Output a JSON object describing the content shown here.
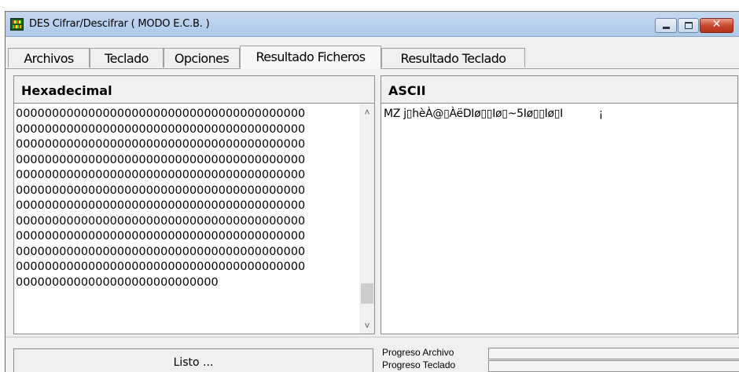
{
  "window": {
    "title": "DES Cifrar/Descifrar ( MODO E.C.B. )",
    "close_glyph": "✕"
  },
  "tabs": [
    {
      "label": "Archivos",
      "active": false
    },
    {
      "label": "Teclado",
      "active": false
    },
    {
      "label": "Opciones",
      "active": false
    },
    {
      "label": "Resultado Ficheros",
      "active": true
    },
    {
      "label": "Resultado Teclado",
      "active": false
    }
  ],
  "hex_pane": {
    "header": "Hexadecimal",
    "lines": [
      "0000000000000000000000000000000000000000",
      "0000000000000000000000000000000000000000",
      "0000000000000000000000000000000000000000",
      "0000000000000000000000000000000000000000",
      "0000000000000000000000000000000000000000",
      "0000000000000000000000000000000000000000",
      "0000000000000000000000000000000000000000",
      "0000000000000000000000000000000000000000",
      "0000000000000000000000000000000000000000",
      "0000000000000000000000000000000000000000",
      "0000000000000000000000000000000000000000",
      "0000000000000000000000000000"
    ],
    "scroll_up_glyph": "˄",
    "scroll_down_glyph": "˅"
  },
  "ascii_pane": {
    "header": "ASCII",
    "text": "MZ j▯hèÀ@▯ÀëDIø▯▯Iø▯~5Iø▯▯Iø▯I           ¡"
  },
  "status": {
    "message": "Listo ...",
    "progress_archivo_label": "Progreso Archivo",
    "progress_teclado_label": "Progreso Teclado",
    "progress_archivo_value": 0,
    "progress_teclado_value": 0
  },
  "colors": {
    "titlebar": "#b9d1ee",
    "close_button": "#c8432a",
    "progress_fill": "#3f9b3f"
  }
}
